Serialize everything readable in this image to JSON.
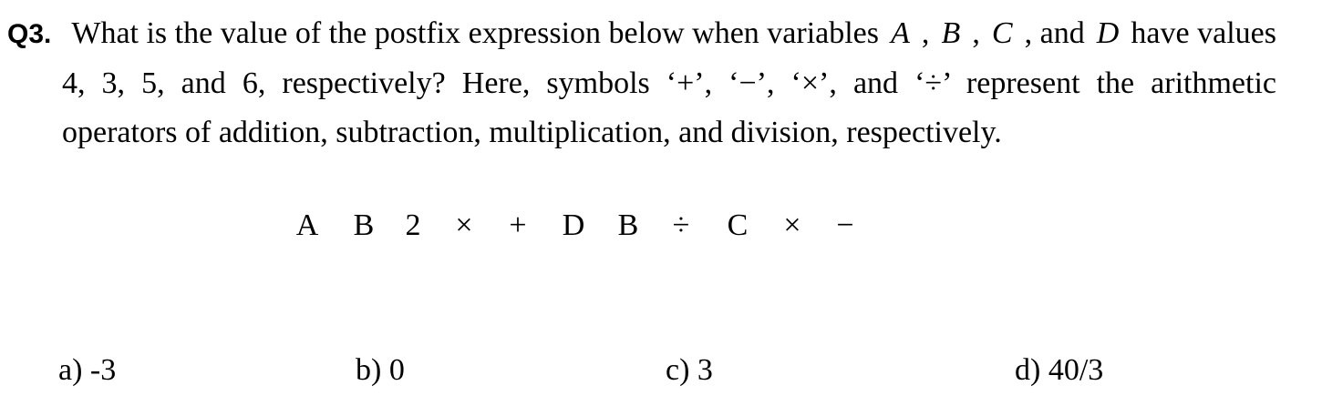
{
  "question": {
    "number": "Q3.",
    "line1": {
      "text_before": "What is the value of the postfix expression below when variables",
      "vars": [
        "A",
        "B",
        "C",
        "D"
      ],
      "sep1": ",",
      "sep2": ",",
      "sep3": ", and",
      "text_after": "have values"
    },
    "line2": "4, 3, 5, and 6, respectively? Here, symbols ‘+’, ‘−’, ‘×’, and ‘÷’ represent the arithmetic",
    "line3": "operators of addition, subtraction, multiplication, and division, respectively."
  },
  "expression": {
    "tokens": [
      "A",
      "B",
      "2",
      "×",
      "+",
      "D",
      "B",
      "÷",
      "C",
      "×",
      "−"
    ]
  },
  "choices": [
    {
      "label": "a) -3"
    },
    {
      "label": "b) 0"
    },
    {
      "label": "c) 3"
    },
    {
      "label": "d) 40/3"
    }
  ]
}
